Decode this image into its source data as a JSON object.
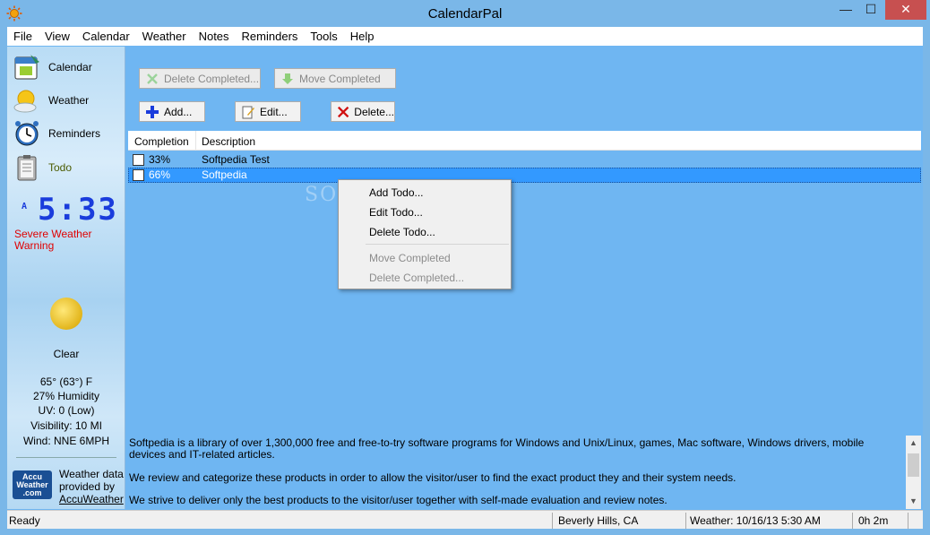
{
  "window": {
    "title": "CalendarPal",
    "minimize": "—",
    "maximize": "☐",
    "close": "✕"
  },
  "menu": [
    "File",
    "View",
    "Calendar",
    "Weather",
    "Notes",
    "Reminders",
    "Tools",
    "Help"
  ],
  "sidebar": {
    "nav": [
      {
        "label": "Calendar",
        "icon": "calendar-icon"
      },
      {
        "label": "Weather",
        "icon": "weather-icon"
      },
      {
        "label": "Reminders",
        "icon": "alarm-clock-icon"
      },
      {
        "label": "Todo",
        "icon": "todo-clipboard-icon"
      }
    ],
    "clock": {
      "ampm": "A",
      "time": "5:33"
    },
    "alert": "Severe Weather Warning",
    "weather": {
      "condition": "Clear",
      "temperature": "65° (63°) F",
      "humidity": "27% Humidity",
      "uv": "UV: 0 (Low)",
      "visibility": "Visibility: 10 MI",
      "wind": "Wind: NNE 6MPH"
    },
    "provider": {
      "logo_line1": "Accu",
      "logo_line2": "Weather",
      "logo_line3": ".com",
      "text1": "Weather data",
      "text2": "provided by",
      "link": "AccuWeather"
    }
  },
  "toolbar": {
    "delete_completed": "Delete Completed...",
    "move_completed": "Move Completed",
    "add": "Add...",
    "edit": "Edit...",
    "delete": "Delete..."
  },
  "list": {
    "columns": [
      "Completion",
      "Description"
    ],
    "rows": [
      {
        "completion": "33%",
        "description": "Softpedia Test",
        "selected": false
      },
      {
        "completion": "66%",
        "description": "Softpedia",
        "selected": true
      }
    ]
  },
  "context_menu": {
    "items": [
      "Add Todo...",
      "Edit Todo...",
      "Delete Todo..."
    ],
    "disabled_items": [
      "Move Completed",
      "Delete Completed..."
    ]
  },
  "description_text": [
    "Softpedia is a library of over 1,300,000 free and free-to-try software programs for Windows and Unix/Linux, games, Mac software, Windows drivers, mobile devices and IT-related articles.",
    "We review and categorize these products in order to allow the visitor/user to find the exact product they and their system needs.",
    "We strive to deliver only the best products to the visitor/user together with self-made evaluation and review notes."
  ],
  "status": {
    "state": "Ready",
    "location": "Beverly Hills, CA",
    "weather_time": "Weather: 10/16/13 5:30 AM",
    "elapsed": "0h 2m"
  },
  "watermark": "SOFTPEDIA",
  "colors": {
    "selection": "#3399ff",
    "alert": "#e00000",
    "clock": "#1a3cdc",
    "close_button": "#c75050"
  }
}
